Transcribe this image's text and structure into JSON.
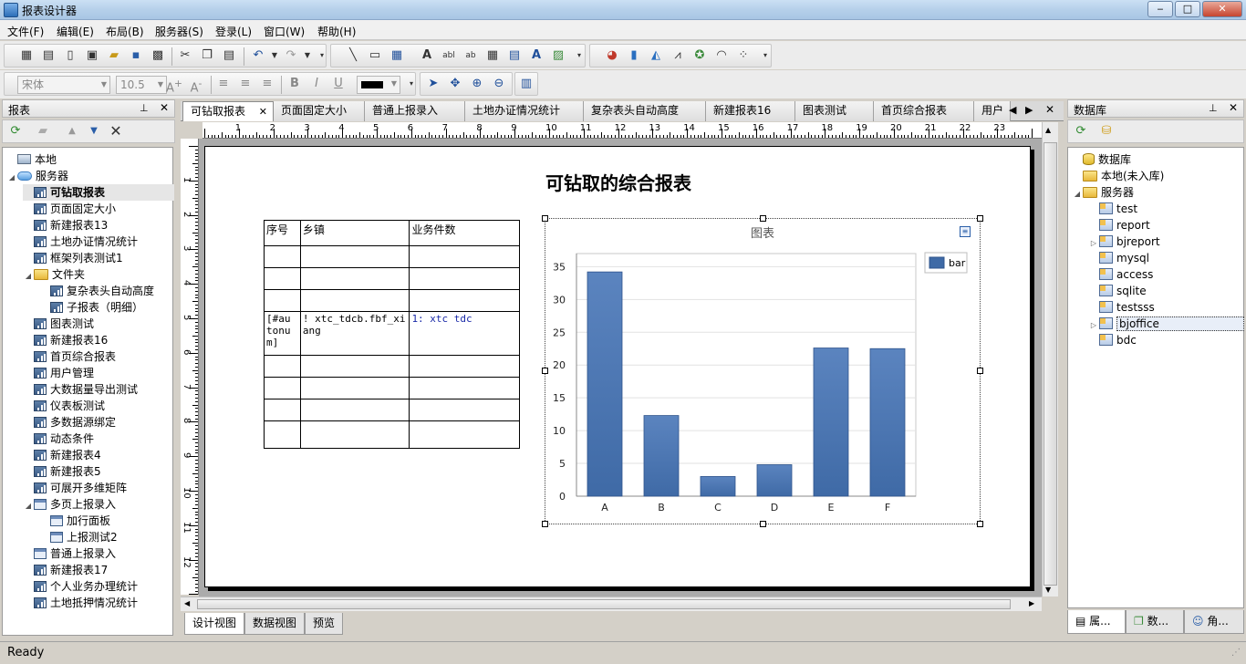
{
  "window": {
    "title": "报表设计器",
    "minimize": "‒",
    "maximize": "□",
    "close": "✕"
  },
  "menu": [
    "文件(F)",
    "编辑(E)",
    "布局(B)",
    "服务器(S)",
    "登录(L)",
    "窗口(W)",
    "帮助(H)"
  ],
  "format_bar": {
    "font_name": "宋体",
    "font_size": "10.5",
    "bold": "B",
    "italic": "I",
    "underline": "U"
  },
  "left_panel": {
    "title": "报表",
    "tree": [
      {
        "label": "本地",
        "icon": "pc",
        "level": 0
      },
      {
        "label": "服务器",
        "icon": "cloud",
        "level": 0,
        "expanded": true
      },
      {
        "label": "可钻取报表",
        "icon": "report",
        "level": 1,
        "selected": true
      },
      {
        "label": "页面固定大小",
        "icon": "report",
        "level": 1
      },
      {
        "label": "新建报表13",
        "icon": "report",
        "level": 1
      },
      {
        "label": "土地办证情况统计",
        "icon": "report",
        "level": 1
      },
      {
        "label": "框架列表测试1",
        "icon": "report",
        "level": 1
      },
      {
        "label": "文件夹",
        "icon": "folder",
        "level": 1,
        "expanded": true
      },
      {
        "label": "复杂表头自动高度",
        "icon": "report",
        "level": 2
      },
      {
        "label": "子报表（明细）",
        "icon": "report",
        "level": 2
      },
      {
        "label": "图表测试",
        "icon": "report",
        "level": 1
      },
      {
        "label": "新建报表16",
        "icon": "report",
        "level": 1
      },
      {
        "label": "首页综合报表",
        "icon": "report",
        "level": 1
      },
      {
        "label": "用户管理",
        "icon": "report",
        "level": 1
      },
      {
        "label": "大数据量导出测试",
        "icon": "report",
        "level": 1
      },
      {
        "label": "仪表板测试",
        "icon": "report",
        "level": 1
      },
      {
        "label": "多数据源绑定",
        "icon": "report",
        "level": 1
      },
      {
        "label": "动态条件",
        "icon": "report",
        "level": 1
      },
      {
        "label": "新建报表4",
        "icon": "report",
        "level": 1
      },
      {
        "label": "新建报表5",
        "icon": "report",
        "level": 1
      },
      {
        "label": "可展开多维矩阵",
        "icon": "report",
        "level": 1
      },
      {
        "label": "多页上报录入",
        "icon": "form",
        "level": 1,
        "expanded": true
      },
      {
        "label": "加行面板",
        "icon": "form",
        "level": 2
      },
      {
        "label": "上报测试2",
        "icon": "form",
        "level": 2
      },
      {
        "label": "普通上报录入",
        "icon": "form",
        "level": 1
      },
      {
        "label": "新建报表17",
        "icon": "report",
        "level": 1
      },
      {
        "label": "个人业务办理统计",
        "icon": "report",
        "level": 1
      },
      {
        "label": "土地抵押情况统计",
        "icon": "report",
        "level": 1
      }
    ]
  },
  "doc_tabs": [
    {
      "label": "可钻取报表",
      "active": true,
      "closable": "✕"
    },
    {
      "label": "页面固定大小"
    },
    {
      "label": "普通上报录入"
    },
    {
      "label": "土地办证情况统计"
    },
    {
      "label": "复杂表头自动高度"
    },
    {
      "label": "新建报表16"
    },
    {
      "label": "图表测试"
    },
    {
      "label": "首页综合报表"
    },
    {
      "label": "用户"
    }
  ],
  "ruler": {
    "h": [
      "1",
      "2",
      "3",
      "4",
      "5",
      "6",
      "7",
      "8",
      "9",
      "10",
      "11",
      "12",
      "13",
      "14",
      "15",
      "16",
      "17",
      "18",
      "19",
      "20",
      "21",
      "22",
      "23"
    ],
    "v": [
      "1",
      "2",
      "3",
      "4",
      "5",
      "6",
      "7",
      "8",
      "9",
      "10",
      "11",
      "12"
    ]
  },
  "report": {
    "title": "可钻取的综合报表",
    "headers": [
      "序号",
      "乡镇",
      "业务件数"
    ],
    "expr_row": [
      "[#au tonum]",
      "! xtc_tdcb.fbf_xiang",
      "1: xtc tdc"
    ]
  },
  "chart_data": {
    "type": "bar",
    "title": "图表",
    "categories": [
      "A",
      "B",
      "C",
      "D",
      "E",
      "F"
    ],
    "series": [
      {
        "name": "bar",
        "values": [
          34.2,
          12.3,
          3.0,
          4.8,
          22.6,
          22.5
        ]
      }
    ],
    "ylim": [
      0,
      37
    ],
    "yticks": [
      0,
      5,
      10,
      15,
      20,
      25,
      30,
      35
    ],
    "grid": true,
    "legend": "top-right",
    "bar_color": "#3f6aa6"
  },
  "bottom_tabs": [
    {
      "label": "设计视图",
      "active": true
    },
    {
      "label": "数据视图"
    },
    {
      "label": "预览"
    }
  ],
  "right_panel": {
    "title": "数据库",
    "tree": [
      {
        "label": "数据库",
        "icon": "db",
        "level": 0
      },
      {
        "label": "本地(未入库)",
        "icon": "folder",
        "level": 0
      },
      {
        "label": "服务器",
        "icon": "folder",
        "level": 0,
        "expanded": true
      },
      {
        "label": "test",
        "icon": "dsrc",
        "level": 1
      },
      {
        "label": "report",
        "icon": "dsrc",
        "level": 1
      },
      {
        "label": "bjreport",
        "icon": "dsrc",
        "level": 1,
        "expandable": true
      },
      {
        "label": "mysql",
        "icon": "dsrc",
        "level": 1
      },
      {
        "label": "access",
        "icon": "dsrc",
        "level": 1
      },
      {
        "label": "sqlite",
        "icon": "dsrc",
        "level": 1
      },
      {
        "label": "testsss",
        "icon": "dsrc",
        "level": 1
      },
      {
        "label": "bjoffice",
        "icon": "dsrc",
        "level": 1,
        "expandable": true,
        "selected": true
      },
      {
        "label": "bdc",
        "icon": "dsrc",
        "level": 1
      }
    ],
    "tabs": [
      "属...",
      "数...",
      "角..."
    ]
  },
  "status": "Ready"
}
